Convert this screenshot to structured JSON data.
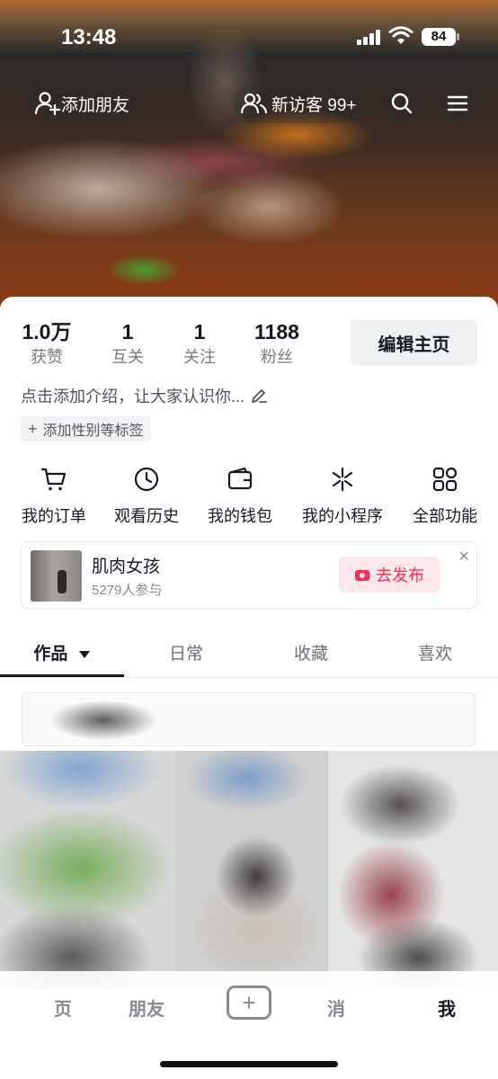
{
  "status_bar": {
    "time": "13:48",
    "battery": "84"
  },
  "top_bar": {
    "add_friend": "添加朋友",
    "visitors": "新访客 99+"
  },
  "stats": [
    {
      "value": "1.0万",
      "label": "获赞"
    },
    {
      "value": "1",
      "label": "互关"
    },
    {
      "value": "1",
      "label": "关注"
    },
    {
      "value": "1188",
      "label": "粉丝"
    }
  ],
  "edit_profile": "编辑主页",
  "bio": "点击添加介绍，让大家认识你...",
  "tag_chip": "添加性别等标签",
  "functions": [
    {
      "label": "我的订单",
      "icon": "cart-icon"
    },
    {
      "label": "观看历史",
      "icon": "clock-icon"
    },
    {
      "label": "我的钱包",
      "icon": "wallet-icon"
    },
    {
      "label": "我的小程序",
      "icon": "mini-program-icon"
    },
    {
      "label": "全部功能",
      "icon": "grid-icon"
    }
  ],
  "promo": {
    "title": "肌肉女孩",
    "count": "5279人参与",
    "button": "去发布",
    "close": "×"
  },
  "tabs": [
    "作品",
    "日常",
    "收藏",
    "喜欢"
  ],
  "bottom_nav": {
    "home": "页",
    "friends": "朋友",
    "create": "+",
    "messages": "消",
    "me": "我"
  },
  "colors": {
    "accent": "#fe2c55",
    "text": "#161823"
  }
}
